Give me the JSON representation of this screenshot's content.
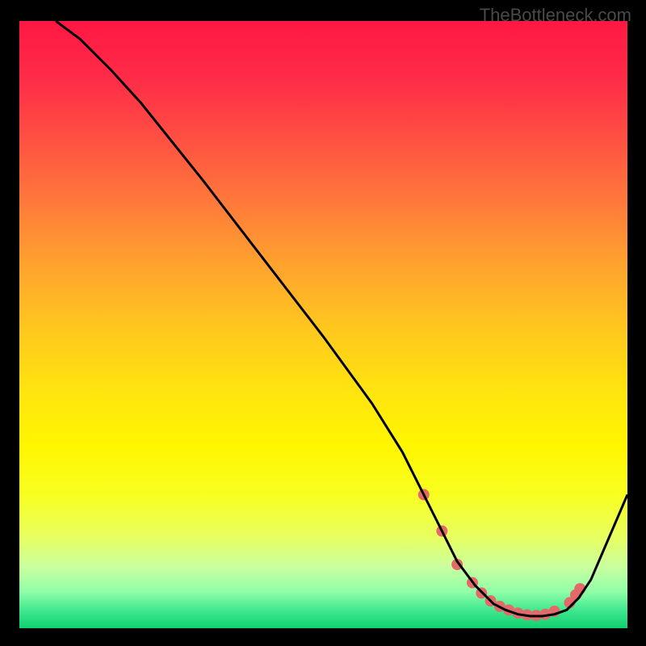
{
  "watermark": "TheBottleneck.com",
  "chart_data": {
    "type": "line",
    "title": "",
    "xlabel": "",
    "ylabel": "",
    "xlim": [
      0,
      100
    ],
    "ylim": [
      0,
      100
    ],
    "grid": false,
    "legend": false,
    "gradient_stops": [
      {
        "offset": 0.0,
        "color": "#ff1744"
      },
      {
        "offset": 0.1,
        "color": "#ff2d47"
      },
      {
        "offset": 0.2,
        "color": "#ff5242"
      },
      {
        "offset": 0.3,
        "color": "#ff7a3a"
      },
      {
        "offset": 0.4,
        "color": "#ffa22e"
      },
      {
        "offset": 0.5,
        "color": "#ffc51f"
      },
      {
        "offset": 0.6,
        "color": "#ffe210"
      },
      {
        "offset": 0.7,
        "color": "#fff600"
      },
      {
        "offset": 0.78,
        "color": "#f8ff20"
      },
      {
        "offset": 0.85,
        "color": "#e8ff60"
      },
      {
        "offset": 0.9,
        "color": "#c8ffa0"
      },
      {
        "offset": 0.94,
        "color": "#90ffa8"
      },
      {
        "offset": 0.97,
        "color": "#40e890"
      },
      {
        "offset": 1.0,
        "color": "#10d070"
      }
    ],
    "series": [
      {
        "name": "bottleneck-curve",
        "color": "#000000",
        "x": [
          6,
          10,
          15,
          20,
          30,
          40,
          50,
          58,
          63,
          66,
          68,
          70,
          72,
          75,
          78,
          80,
          82,
          84,
          86,
          88,
          90,
          92,
          94,
          100
        ],
        "y": [
          100,
          97,
          92,
          86.5,
          74,
          61,
          48,
          37,
          29,
          23,
          19,
          15,
          11,
          7,
          4,
          3,
          2.3,
          2,
          2,
          2.3,
          3,
          5,
          8,
          22
        ]
      }
    ],
    "markers": {
      "name": "highlight-points",
      "color": "#e46a6a",
      "radius": 7,
      "points": [
        {
          "x": 66.5,
          "y": 22
        },
        {
          "x": 69.5,
          "y": 16
        },
        {
          "x": 72.0,
          "y": 10.5
        },
        {
          "x": 74.5,
          "y": 7.5
        },
        {
          "x": 76.0,
          "y": 5.8
        },
        {
          "x": 77.5,
          "y": 4.5
        },
        {
          "x": 79.0,
          "y": 3.6
        },
        {
          "x": 80.5,
          "y": 3.0
        },
        {
          "x": 82.0,
          "y": 2.5
        },
        {
          "x": 83.5,
          "y": 2.2
        },
        {
          "x": 85.0,
          "y": 2.1
        },
        {
          "x": 86.5,
          "y": 2.3
        },
        {
          "x": 88.0,
          "y": 2.8
        },
        {
          "x": 90.5,
          "y": 4.2
        },
        {
          "x": 91.5,
          "y": 5.5
        },
        {
          "x": 92.2,
          "y": 6.5
        }
      ]
    }
  }
}
